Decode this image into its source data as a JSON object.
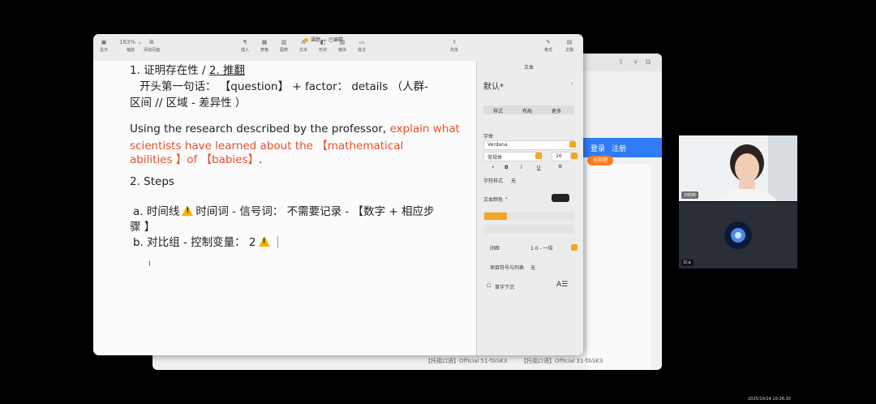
{
  "background_window": {
    "nav": [
      "登录",
      "注册"
    ],
    "pill": "全部题",
    "footer": [
      "【托福口语】Official 51-TASK3",
      "【托福口语】Official 31-TASK3"
    ]
  },
  "toolbar": {
    "zoom": "163% ⌄",
    "items": [
      "显示",
      "缩放",
      "添加页面",
      "插入",
      "表格",
      "图表",
      "文本",
      "形状",
      "媒体",
      "批注",
      "共享",
      "格式",
      "文稿"
    ],
    "title": "课题",
    "title_suffix": "— 已编辑"
  },
  "document": {
    "line1_prefix": "1. 证明存在性 / ",
    "line1_underlined": "2. 推翻",
    "line2": "开头第一句话：   【question】 + factor：  details （人群-",
    "line3": "区间  // 区域 - 差异性 ）",
    "line4_black": "Using the research described by the professor, ",
    "line4_red": "explain what",
    "line5_red": "scientists have learned about the 【mathematical",
    "line6_red": "abilities 】of 【babies】",
    "line6_black": ".",
    "line7": "2.  Steps",
    "line8a": "a. 时间线",
    "line8b": "时间词 - 信号词： 不需要记录 - 【数字 + 相应步",
    "line9": "骤 】",
    "line10": "b. 对比组 - 控制变量： 2",
    "cursor_glyph": "I"
  },
  "inspector": {
    "header": "文本",
    "style_name": "默认*",
    "tabs": [
      "样式",
      "布局",
      "更多"
    ],
    "font_label": "字体",
    "font_name": "Verdana",
    "font_weight": "常规体",
    "font_size": "16",
    "bold": "B",
    "italic": "I",
    "underline": "U",
    "char_style_label": "字符样式",
    "char_style_value": "无",
    "text_color_label": "文本颜色 ⌃",
    "spacing_label": "间距",
    "spacing_value": "1.0 - 一倍",
    "bullets_label": "项目符号与列表",
    "bullets_value": "无",
    "dropcap_label": "首字下沉",
    "accent": "#f5a623"
  },
  "video": {
    "tile1_name": "刘莉莉",
    "tile2_name": "D.o"
  },
  "timestamp": "2025/10/14 10:26:30"
}
